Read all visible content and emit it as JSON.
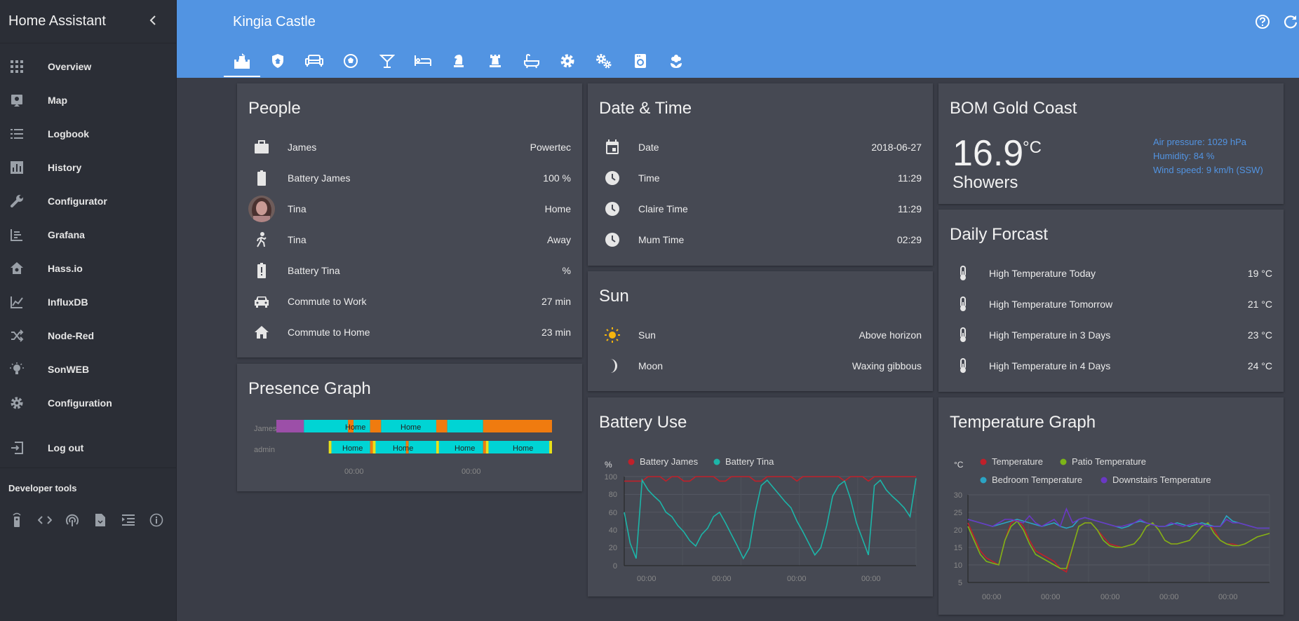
{
  "app_title": "Home Assistant",
  "sidebar": {
    "items": [
      {
        "label": "Overview",
        "icon": "grid-icon"
      },
      {
        "label": "Map",
        "icon": "map-icon"
      },
      {
        "label": "Logbook",
        "icon": "list-icon"
      },
      {
        "label": "History",
        "icon": "chart-bar-icon"
      },
      {
        "label": "Configurator",
        "icon": "wrench-icon"
      },
      {
        "label": "Grafana",
        "icon": "chart-icon"
      },
      {
        "label": "Hass.io",
        "icon": "hassio-icon"
      },
      {
        "label": "InfluxDB",
        "icon": "chart-line-icon"
      },
      {
        "label": "Node-Red",
        "icon": "shuffle-icon"
      },
      {
        "label": "SonWEB",
        "icon": "bulb-icon"
      },
      {
        "label": "Configuration",
        "icon": "gear-icon"
      },
      {
        "label": "Log out",
        "icon": "exit-icon"
      }
    ],
    "developer_tools_title": "Developer tools",
    "developer_tools": [
      "remote-icon",
      "code-icon",
      "mqtt-icon",
      "file-icon",
      "indent-icon",
      "info-icon"
    ]
  },
  "header": {
    "title": "Kingia Castle",
    "tabs": [
      "castle-icon",
      "shield-home-icon",
      "sofa-icon",
      "soccer-icon",
      "cocktail-icon",
      "bed-icon",
      "chess-knight-icon",
      "chess-rook-icon",
      "bathtub-icon",
      "settings-icon",
      "settings-cogs-icon",
      "washing-machine-icon",
      "flower-icon"
    ]
  },
  "people": {
    "title": "People",
    "rows": [
      {
        "name": "James",
        "value": "Powertec",
        "icon": "briefcase-icon"
      },
      {
        "name": "Battery James",
        "value": "100 %",
        "icon": "battery-icon"
      },
      {
        "name": "Tina",
        "value": "Home",
        "icon": "avatar"
      },
      {
        "name": "Tina",
        "value": "Away",
        "icon": "walk-icon"
      },
      {
        "name": "Battery Tina",
        "value": "%",
        "icon": "battery-alert-icon"
      },
      {
        "name": "Commute to Work",
        "value": "27 min",
        "icon": "car-icon"
      },
      {
        "name": "Commute to Home",
        "value": "23 min",
        "icon": "home-icon"
      }
    ]
  },
  "presence": {
    "title": "Presence Graph",
    "rows": [
      {
        "label": "James",
        "states": [
          "Home",
          "Home"
        ]
      },
      {
        "label": "admin",
        "states": [
          "Home",
          "Home",
          "Home",
          "Home"
        ]
      }
    ],
    "times": [
      "00:00",
      "00:00"
    ],
    "colors": {
      "home": "#00d4d4",
      "away": "#f07b0f",
      "other": "#9c4fa8",
      "yellow": "#e8e11a"
    }
  },
  "datetime": {
    "title": "Date & Time",
    "rows": [
      {
        "name": "Date",
        "value": "2018-06-27",
        "icon": "calendar-icon"
      },
      {
        "name": "Time",
        "value": "11:29",
        "icon": "clock-icon"
      },
      {
        "name": "Claire Time",
        "value": "11:29",
        "icon": "clock-icon"
      },
      {
        "name": "Mum Time",
        "value": "02:29",
        "icon": "clock-icon"
      }
    ]
  },
  "sun": {
    "title": "Sun",
    "rows": [
      {
        "name": "Sun",
        "value": "Above horizon",
        "icon": "sun-icon"
      },
      {
        "name": "Moon",
        "value": "Waxing gibbous",
        "icon": "moon-icon"
      }
    ]
  },
  "battery_chart": {
    "title": "Battery Use",
    "unit": "%",
    "yticks": [
      "100",
      "80",
      "60",
      "40",
      "20",
      "0"
    ],
    "xticks": [
      "00:00",
      "00:00",
      "00:00",
      "00:00"
    ]
  },
  "weather": {
    "title": "BOM Gold Coast",
    "temp": "16.9",
    "temp_unit": "°C",
    "condition": "Showers",
    "pressure": "Air pressure: 1029 hPa",
    "humidity": "Humidity: 84 %",
    "wind": "Wind speed: 9 km/h (SSW)"
  },
  "forecast": {
    "title": "Daily Forcast",
    "rows": [
      {
        "name": "High Temperature Today",
        "value": "19 °C",
        "icon": "thermometer-icon"
      },
      {
        "name": "High Temperature Tomorrow",
        "value": "21 °C",
        "icon": "thermometer-icon"
      },
      {
        "name": "High Temperature in 3 Days",
        "value": "23 °C",
        "icon": "thermometer-icon"
      },
      {
        "name": "High Temperature in 4 Days",
        "value": "24 °C",
        "icon": "thermometer-icon"
      }
    ]
  },
  "temp_chart": {
    "title": "Temperature Graph",
    "unit": "°C",
    "yticks": [
      "30",
      "25",
      "20",
      "15",
      "10",
      "5"
    ],
    "xticks": [
      "00:00",
      "00:00",
      "00:00",
      "00:00",
      "00:00"
    ]
  },
  "chart_data": [
    {
      "type": "line",
      "ylabel": "%",
      "ylim": [
        0,
        100
      ],
      "grid": true,
      "legend": "top-left",
      "series": [
        {
          "name": "Battery James",
          "color": "#c0202a",
          "values": [
            95,
            95,
            95,
            95,
            100,
            100,
            100,
            95,
            100,
            100,
            95,
            95,
            100,
            100,
            100,
            100,
            95,
            95,
            100,
            100,
            100,
            100,
            95,
            95,
            100,
            100,
            100,
            100,
            100,
            95,
            100,
            100,
            100,
            100,
            100,
            100,
            100,
            95,
            100,
            100,
            100,
            95,
            100,
            100,
            100,
            100,
            100,
            100,
            100,
            100
          ]
        },
        {
          "name": "Battery Tina",
          "color": "#1cb5a8",
          "values": [
            60,
            25,
            8,
            96,
            85,
            78,
            72,
            60,
            55,
            45,
            38,
            28,
            22,
            35,
            42,
            55,
            60,
            48,
            35,
            22,
            8,
            20,
            60,
            90,
            96,
            88,
            80,
            72,
            65,
            50,
            38,
            25,
            12,
            20,
            45,
            78,
            90,
            95,
            75,
            48,
            30,
            12,
            90,
            96,
            85,
            78,
            72,
            65,
            55,
            98
          ]
        }
      ]
    },
    {
      "type": "line",
      "ylabel": "°C",
      "ylim": [
        5,
        30
      ],
      "grid": true,
      "legend": "top-left",
      "series": [
        {
          "name": "Temperature",
          "color": "#c0202a",
          "values": [
            22,
            18,
            14,
            12,
            11,
            10,
            17,
            22,
            23,
            21,
            17,
            14,
            13,
            12,
            11,
            9,
            8,
            15,
            21,
            22,
            22,
            20,
            18,
            16,
            15.5,
            15,
            15.5,
            16,
            18,
            21,
            22,
            20,
            17,
            16,
            16,
            16.5,
            17,
            19,
            21,
            22,
            20,
            17,
            16,
            16,
            15.5,
            16,
            17,
            18,
            18.5,
            19
          ]
        },
        {
          "name": "Patio Temperature",
          "color": "#7cb518",
          "values": [
            21,
            17,
            13,
            11,
            10.5,
            10,
            17,
            21,
            22.5,
            20,
            16,
            13,
            12,
            11,
            10,
            9,
            9,
            15,
            21,
            22,
            22,
            20,
            17,
            15.5,
            15,
            15,
            15.5,
            16,
            18,
            21,
            22,
            20,
            17,
            16,
            16,
            16.5,
            17,
            19,
            21,
            22,
            19,
            17,
            16,
            15.5,
            15.5,
            16,
            17,
            18,
            18.5,
            19
          ]
        },
        {
          "name": "Bedroom Temperature",
          "color": "#2ba4c4",
          "values": [
            23,
            22.5,
            22,
            21.5,
            21,
            21.5,
            22,
            22.5,
            23,
            22.5,
            22,
            21.5,
            21,
            21.5,
            22,
            21,
            20.5,
            21,
            23,
            23.5,
            23,
            22.5,
            22,
            21.5,
            21,
            20.5,
            21,
            22,
            22.5,
            22,
            21.5,
            21,
            21,
            21.5,
            22,
            21.5,
            21,
            21.5,
            22,
            21.5,
            21,
            21,
            24,
            22.5,
            22,
            21.5,
            21,
            20.5,
            20.5,
            20.5
          ]
        },
        {
          "name": "Downstairs Temperature",
          "color": "#6a38c4",
          "values": [
            23,
            22.5,
            22,
            21.5,
            21,
            22,
            23,
            23,
            22.5,
            22,
            24,
            22,
            21,
            22,
            23,
            21,
            26,
            22,
            23,
            23.5,
            23,
            22.5,
            22,
            21.5,
            21,
            21,
            21.5,
            22,
            23,
            22,
            21.5,
            21,
            21,
            22,
            21.5,
            21,
            21.5,
            22,
            21.5,
            21,
            21,
            21,
            23,
            22,
            22,
            21.5,
            21,
            20.5,
            20.5,
            20.5
          ]
        }
      ]
    }
  ]
}
